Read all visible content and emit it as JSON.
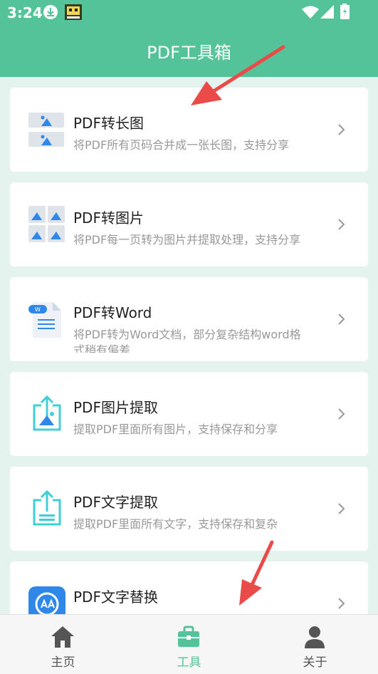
{
  "status": {
    "time": "3:24"
  },
  "header": {
    "title": "PDF工具箱"
  },
  "tools": [
    {
      "title": "PDF转长图",
      "desc": "将PDF所有页码合并成一张长图，支持分享",
      "icon": "long-image-icon"
    },
    {
      "title": "PDF转图片",
      "desc": "将PDF每一页转为图片并提取处理，支持分享",
      "icon": "images-grid-icon"
    },
    {
      "title": "PDF转Word",
      "desc": "将PDF转为Word文档，部分复杂结构word格式稍有偏差",
      "icon": "word-document-icon"
    },
    {
      "title": "PDF图片提取",
      "desc": "提取PDF里面所有图片，支持保存和分享",
      "icon": "image-extract-icon"
    },
    {
      "title": "PDF文字提取",
      "desc": "提取PDF里面所有文字，支持保存和复杂",
      "icon": "text-extract-icon"
    },
    {
      "title": "PDF文字替换",
      "desc": "",
      "icon": "text-replace-icon"
    }
  ],
  "nav": {
    "home": "主页",
    "tools": "工具",
    "about": "关于"
  },
  "colors": {
    "accent": "#55c39a",
    "icon_blue": "#2f88e8",
    "icon_teal": "#3fcfd6"
  }
}
